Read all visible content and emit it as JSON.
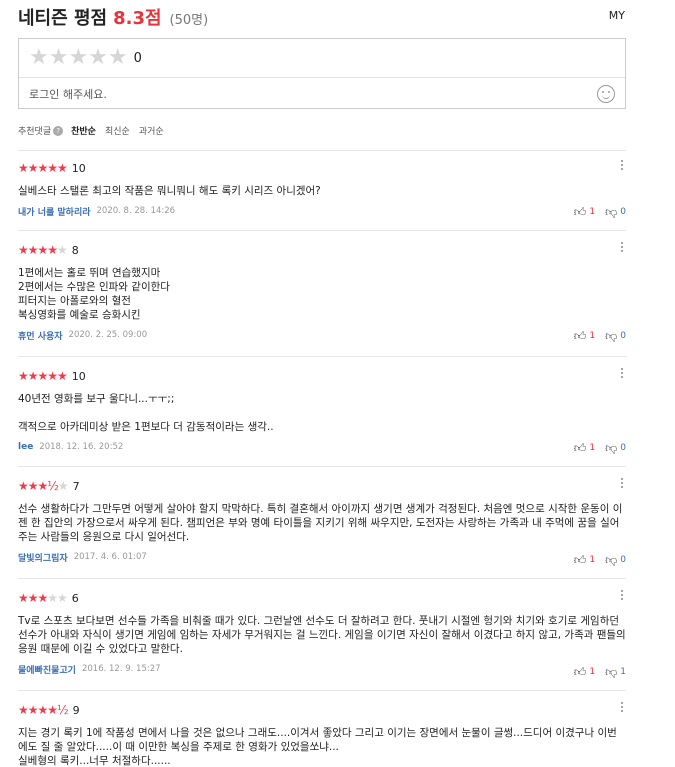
{
  "header": {
    "title": "네티즌 평점",
    "score": "8.3점",
    "count": "(50명)",
    "my_link": "MY"
  },
  "write": {
    "stars": "★★★★★",
    "rating": "0",
    "prompt": "로그인 해주세요."
  },
  "sort": {
    "label": "추천댓글",
    "help": "?",
    "items": [
      "찬반순",
      "최신순",
      "과거순"
    ],
    "active": "찬반순"
  },
  "reviews": [
    {
      "stars_on": "★★★★★",
      "stars_off": "",
      "rating": "10",
      "text": "실베스타 스탤론 최고의 작품은 뭐니뭐니 해도 록키 시리즈 아니겠어?",
      "author": "내가 너를 말하리라",
      "date": "2020. 8. 28. 14:26",
      "up": "1",
      "down": "0"
    },
    {
      "stars_on": "★★★★",
      "stars_off": "★",
      "rating": "8",
      "text": "1편에서는 홀로 뛰며 연습했지마\n2편에서는 수많은 인파와 같이한다\n피터지는 아폴로와의 혈전\n복싱영화를 예술로 승화시킨",
      "author": "휴먼 사용자",
      "date": "2020. 2. 25. 09:00",
      "up": "1",
      "down": "0"
    },
    {
      "stars_on": "★★★★★",
      "stars_off": "",
      "rating": "10",
      "text": "40년전 영화를 보구 울다니...ㅜㅜ;;\n\n객적으로 아카데미상 받은 1편보다 더 감동적이라는 생각..",
      "author": "lee",
      "date": "2018. 12. 16. 20:52",
      "up": "1",
      "down": "0"
    },
    {
      "stars_on": "★★★½",
      "stars_off": "★",
      "rating": "7",
      "text": "선수 생활하다가 그만두면 어떻게 살아야 할지 막막하다. 특히 결혼해서 아이까지 생기면 생계가 걱정된다. 처음엔 멋으로 시작한 운동이 이젠 한 집안의 가장으로서 싸우게 된다. 챔피언은 부와 명예 타이틀을 지키기 위해 싸우지만, 도전자는 사랑하는 가족과 내 주먹에 꿈을 실어주는 사람들의 응원으로 다시 일어선다.",
      "author": "달빛의그림자",
      "date": "2017. 4. 6. 01:07",
      "up": "1",
      "down": "0"
    },
    {
      "stars_on": "★★★",
      "stars_off": "★★",
      "rating": "6",
      "text": "Tv로 스포츠 보다보면 선수들 가족을 비춰줄 때가 있다. 그런날엔 선수도 더 잘하려고 한다. 풋내기 시절엔 헝기와 치기와 호기로 게임하던 선수가 아내와 자식이 생기면 게임에 임하는 자세가 무거워지는 걸 느낀다. 게임을 이기면 자신이 잘해서 이겼다고 하지 않고, 가족과 팬들의 응원 때문에 이길 수 있었다고 말한다.",
      "author": "물에빠진물고기",
      "date": "2016. 12. 9. 15:27",
      "up": "1",
      "down": "1"
    },
    {
      "stars_on": "★★★★½",
      "stars_off": "",
      "rating": "9",
      "text": "지는 경기 록키 1에 작품성 면에서 나을 것은 없으나 그래도....이겨서 좋았다 그리고 이기는 장면에서 눈물이 글썽...드디어 이겼구나 이번에도 질 줄 알았다.....이 때 이만한 복싱을 주제로 한 영화가 있었을쏘냐...\n실베형의 록키...너무 처절하다......",
      "author": "",
      "date": "",
      "up": "",
      "down": ""
    }
  ]
}
